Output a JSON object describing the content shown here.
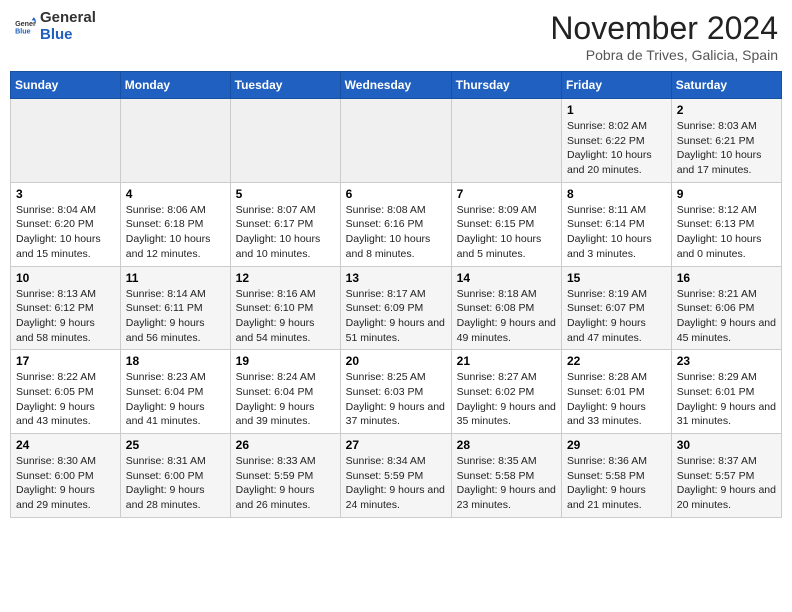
{
  "header": {
    "logo_general": "General",
    "logo_blue": "Blue",
    "month_title": "November 2024",
    "location": "Pobra de Trives, Galicia, Spain"
  },
  "calendar": {
    "weekdays": [
      "Sunday",
      "Monday",
      "Tuesday",
      "Wednesday",
      "Thursday",
      "Friday",
      "Saturday"
    ],
    "weeks": [
      [
        {
          "day": "",
          "info": ""
        },
        {
          "day": "",
          "info": ""
        },
        {
          "day": "",
          "info": ""
        },
        {
          "day": "",
          "info": ""
        },
        {
          "day": "",
          "info": ""
        },
        {
          "day": "1",
          "info": "Sunrise: 8:02 AM\nSunset: 6:22 PM\nDaylight: 10 hours and 20 minutes."
        },
        {
          "day": "2",
          "info": "Sunrise: 8:03 AM\nSunset: 6:21 PM\nDaylight: 10 hours and 17 minutes."
        }
      ],
      [
        {
          "day": "3",
          "info": "Sunrise: 8:04 AM\nSunset: 6:20 PM\nDaylight: 10 hours and 15 minutes."
        },
        {
          "day": "4",
          "info": "Sunrise: 8:06 AM\nSunset: 6:18 PM\nDaylight: 10 hours and 12 minutes."
        },
        {
          "day": "5",
          "info": "Sunrise: 8:07 AM\nSunset: 6:17 PM\nDaylight: 10 hours and 10 minutes."
        },
        {
          "day": "6",
          "info": "Sunrise: 8:08 AM\nSunset: 6:16 PM\nDaylight: 10 hours and 8 minutes."
        },
        {
          "day": "7",
          "info": "Sunrise: 8:09 AM\nSunset: 6:15 PM\nDaylight: 10 hours and 5 minutes."
        },
        {
          "day": "8",
          "info": "Sunrise: 8:11 AM\nSunset: 6:14 PM\nDaylight: 10 hours and 3 minutes."
        },
        {
          "day": "9",
          "info": "Sunrise: 8:12 AM\nSunset: 6:13 PM\nDaylight: 10 hours and 0 minutes."
        }
      ],
      [
        {
          "day": "10",
          "info": "Sunrise: 8:13 AM\nSunset: 6:12 PM\nDaylight: 9 hours and 58 minutes."
        },
        {
          "day": "11",
          "info": "Sunrise: 8:14 AM\nSunset: 6:11 PM\nDaylight: 9 hours and 56 minutes."
        },
        {
          "day": "12",
          "info": "Sunrise: 8:16 AM\nSunset: 6:10 PM\nDaylight: 9 hours and 54 minutes."
        },
        {
          "day": "13",
          "info": "Sunrise: 8:17 AM\nSunset: 6:09 PM\nDaylight: 9 hours and 51 minutes."
        },
        {
          "day": "14",
          "info": "Sunrise: 8:18 AM\nSunset: 6:08 PM\nDaylight: 9 hours and 49 minutes."
        },
        {
          "day": "15",
          "info": "Sunrise: 8:19 AM\nSunset: 6:07 PM\nDaylight: 9 hours and 47 minutes."
        },
        {
          "day": "16",
          "info": "Sunrise: 8:21 AM\nSunset: 6:06 PM\nDaylight: 9 hours and 45 minutes."
        }
      ],
      [
        {
          "day": "17",
          "info": "Sunrise: 8:22 AM\nSunset: 6:05 PM\nDaylight: 9 hours and 43 minutes."
        },
        {
          "day": "18",
          "info": "Sunrise: 8:23 AM\nSunset: 6:04 PM\nDaylight: 9 hours and 41 minutes."
        },
        {
          "day": "19",
          "info": "Sunrise: 8:24 AM\nSunset: 6:04 PM\nDaylight: 9 hours and 39 minutes."
        },
        {
          "day": "20",
          "info": "Sunrise: 8:25 AM\nSunset: 6:03 PM\nDaylight: 9 hours and 37 minutes."
        },
        {
          "day": "21",
          "info": "Sunrise: 8:27 AM\nSunset: 6:02 PM\nDaylight: 9 hours and 35 minutes."
        },
        {
          "day": "22",
          "info": "Sunrise: 8:28 AM\nSunset: 6:01 PM\nDaylight: 9 hours and 33 minutes."
        },
        {
          "day": "23",
          "info": "Sunrise: 8:29 AM\nSunset: 6:01 PM\nDaylight: 9 hours and 31 minutes."
        }
      ],
      [
        {
          "day": "24",
          "info": "Sunrise: 8:30 AM\nSunset: 6:00 PM\nDaylight: 9 hours and 29 minutes."
        },
        {
          "day": "25",
          "info": "Sunrise: 8:31 AM\nSunset: 6:00 PM\nDaylight: 9 hours and 28 minutes."
        },
        {
          "day": "26",
          "info": "Sunrise: 8:33 AM\nSunset: 5:59 PM\nDaylight: 9 hours and 26 minutes."
        },
        {
          "day": "27",
          "info": "Sunrise: 8:34 AM\nSunset: 5:59 PM\nDaylight: 9 hours and 24 minutes."
        },
        {
          "day": "28",
          "info": "Sunrise: 8:35 AM\nSunset: 5:58 PM\nDaylight: 9 hours and 23 minutes."
        },
        {
          "day": "29",
          "info": "Sunrise: 8:36 AM\nSunset: 5:58 PM\nDaylight: 9 hours and 21 minutes."
        },
        {
          "day": "30",
          "info": "Sunrise: 8:37 AM\nSunset: 5:57 PM\nDaylight: 9 hours and 20 minutes."
        }
      ]
    ]
  }
}
